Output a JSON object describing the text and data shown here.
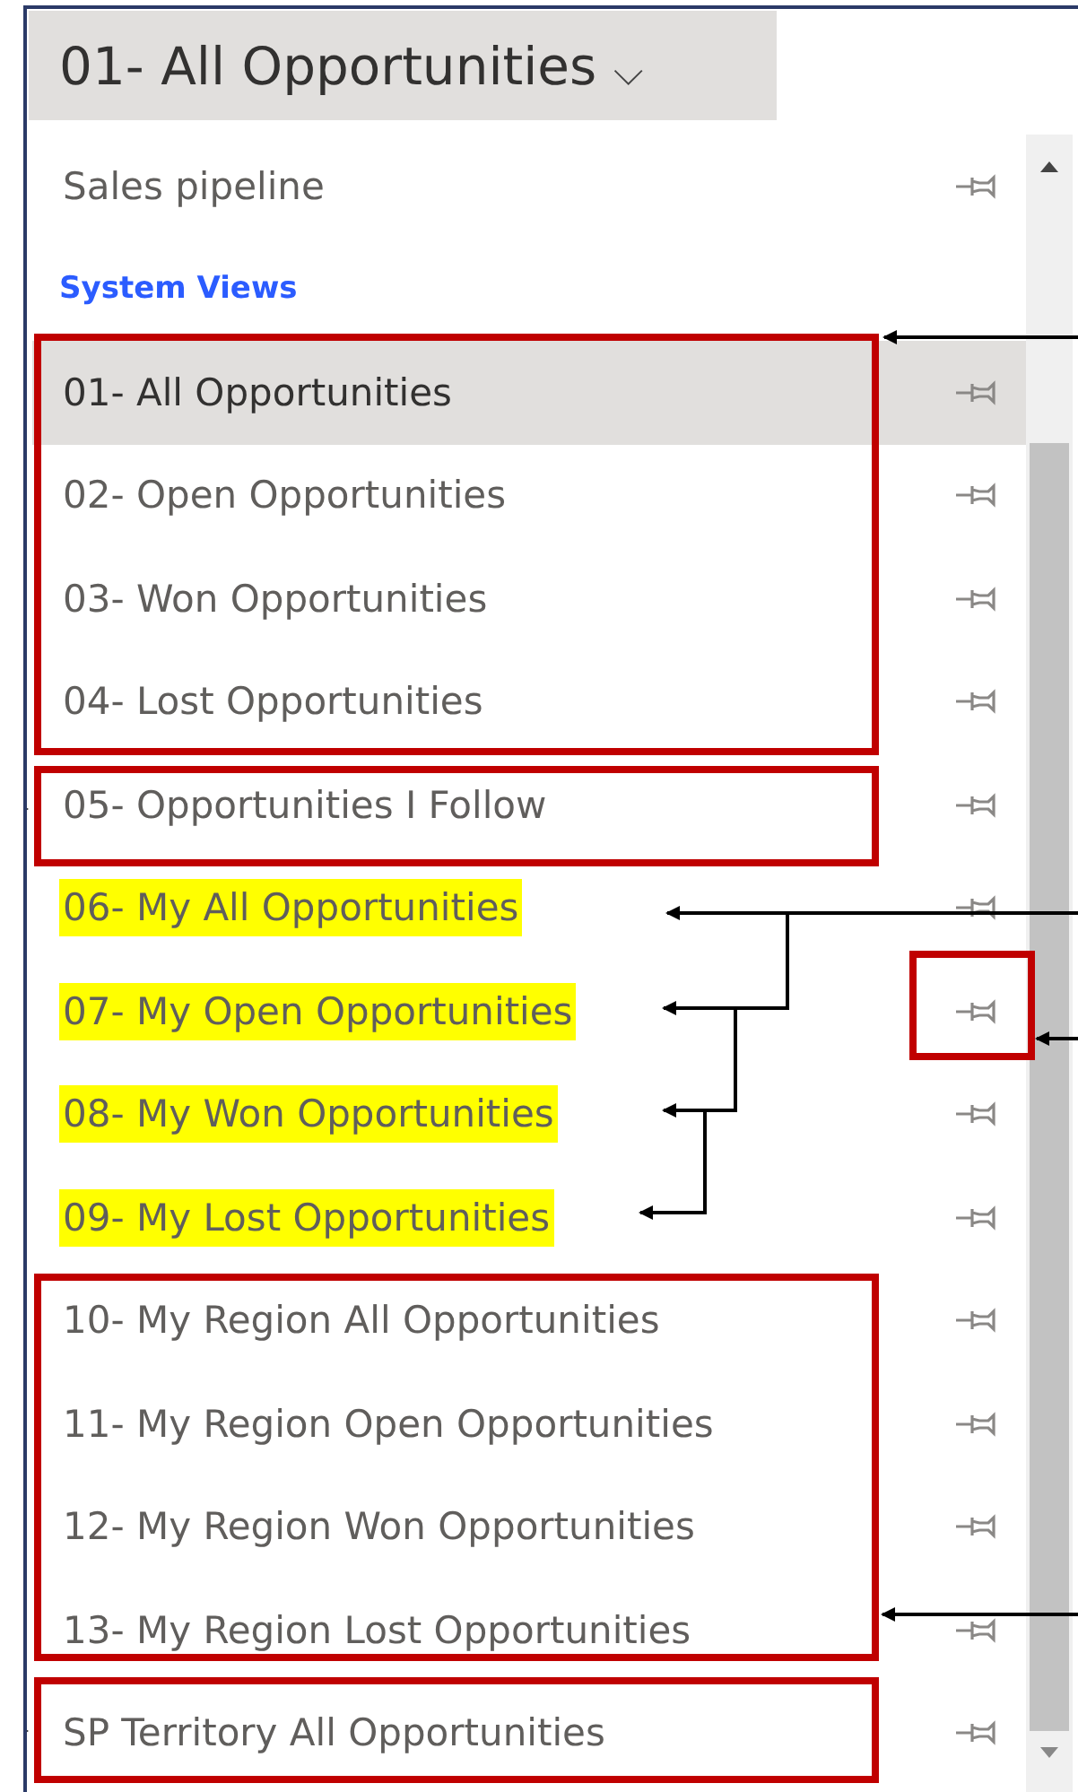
{
  "view_selector": {
    "title": "01- All Opportunities",
    "caret": "⌵"
  },
  "views": [
    {
      "kind": "view",
      "label": "Sales pipeline",
      "selected": false,
      "highlighted": false
    },
    {
      "kind": "heading",
      "label": "System Views"
    },
    {
      "kind": "view",
      "label": "01- All Opportunities",
      "selected": true,
      "highlighted": false
    },
    {
      "kind": "view",
      "label": "02- Open Opportunities",
      "selected": false,
      "highlighted": false
    },
    {
      "kind": "view",
      "label": "03- Won Opportunities",
      "selected": false,
      "highlighted": false
    },
    {
      "kind": "view",
      "label": "04- Lost Opportunities",
      "selected": false,
      "highlighted": false
    },
    {
      "kind": "view",
      "label": "05- Opportunities I Follow",
      "selected": false,
      "highlighted": false
    },
    {
      "kind": "view",
      "label": "06- My All Opportunities",
      "selected": false,
      "highlighted": true
    },
    {
      "kind": "view",
      "label": "07- My Open Opportunities",
      "selected": false,
      "highlighted": true
    },
    {
      "kind": "view",
      "label": "08- My Won Opportunities",
      "selected": false,
      "highlighted": true
    },
    {
      "kind": "view",
      "label": "09- My Lost Opportunities",
      "selected": false,
      "highlighted": true
    },
    {
      "kind": "view",
      "label": "10- My Region All Opportunities",
      "selected": false,
      "highlighted": false
    },
    {
      "kind": "view",
      "label": "11- My Region Open Opportunities",
      "selected": false,
      "highlighted": false
    },
    {
      "kind": "view",
      "label": "12- My Region Won Opportunities",
      "selected": false,
      "highlighted": false
    },
    {
      "kind": "view",
      "label": "13- My Region Lost Opportunities",
      "selected": false,
      "highlighted": false
    },
    {
      "kind": "view",
      "label": "SP Territory All Opportunities",
      "selected": false,
      "highlighted": false
    }
  ]
}
